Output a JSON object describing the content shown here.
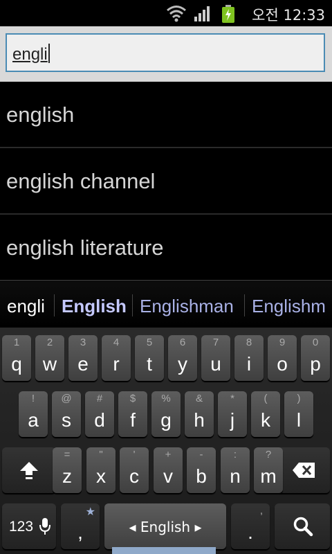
{
  "status": {
    "ampm": "오전",
    "time": "12:33"
  },
  "search": {
    "query": "engli"
  },
  "suggestions": [
    "english",
    "english channel",
    "english literature"
  ],
  "candidates": [
    "engli",
    "English",
    "Englishman",
    "Englishm"
  ],
  "keyboard": {
    "row1": [
      [
        "1",
        "q"
      ],
      [
        "2",
        "w"
      ],
      [
        "3",
        "e"
      ],
      [
        "4",
        "r"
      ],
      [
        "5",
        "t"
      ],
      [
        "6",
        "y"
      ],
      [
        "7",
        "u"
      ],
      [
        "8",
        "i"
      ],
      [
        "9",
        "o"
      ],
      [
        "0",
        "p"
      ]
    ],
    "row2": [
      [
        "!",
        "a"
      ],
      [
        "@",
        "s"
      ],
      [
        "#",
        "d"
      ],
      [
        "$",
        "f"
      ],
      [
        "%",
        "g"
      ],
      [
        "&",
        "h"
      ],
      [
        "*",
        "j"
      ],
      [
        "(",
        "k"
      ],
      [
        ")",
        "l"
      ]
    ],
    "row3": [
      [
        "=",
        "z"
      ],
      [
        "\"",
        "x"
      ],
      [
        "'",
        "c"
      ],
      [
        "+",
        "v"
      ],
      [
        "-",
        "b"
      ],
      [
        ":",
        "n"
      ],
      [
        "?",
        "m"
      ]
    ],
    "numbers_label": "123",
    "comma_label": ",",
    "comma_hint": "★",
    "space_label": "◂ English ▸",
    "period_label": ".",
    "period_hint": ","
  },
  "colors": {
    "accent": "#4a8bb4",
    "candidate_bold": "#c5c9ff",
    "candidate": "#a9b1e6"
  }
}
